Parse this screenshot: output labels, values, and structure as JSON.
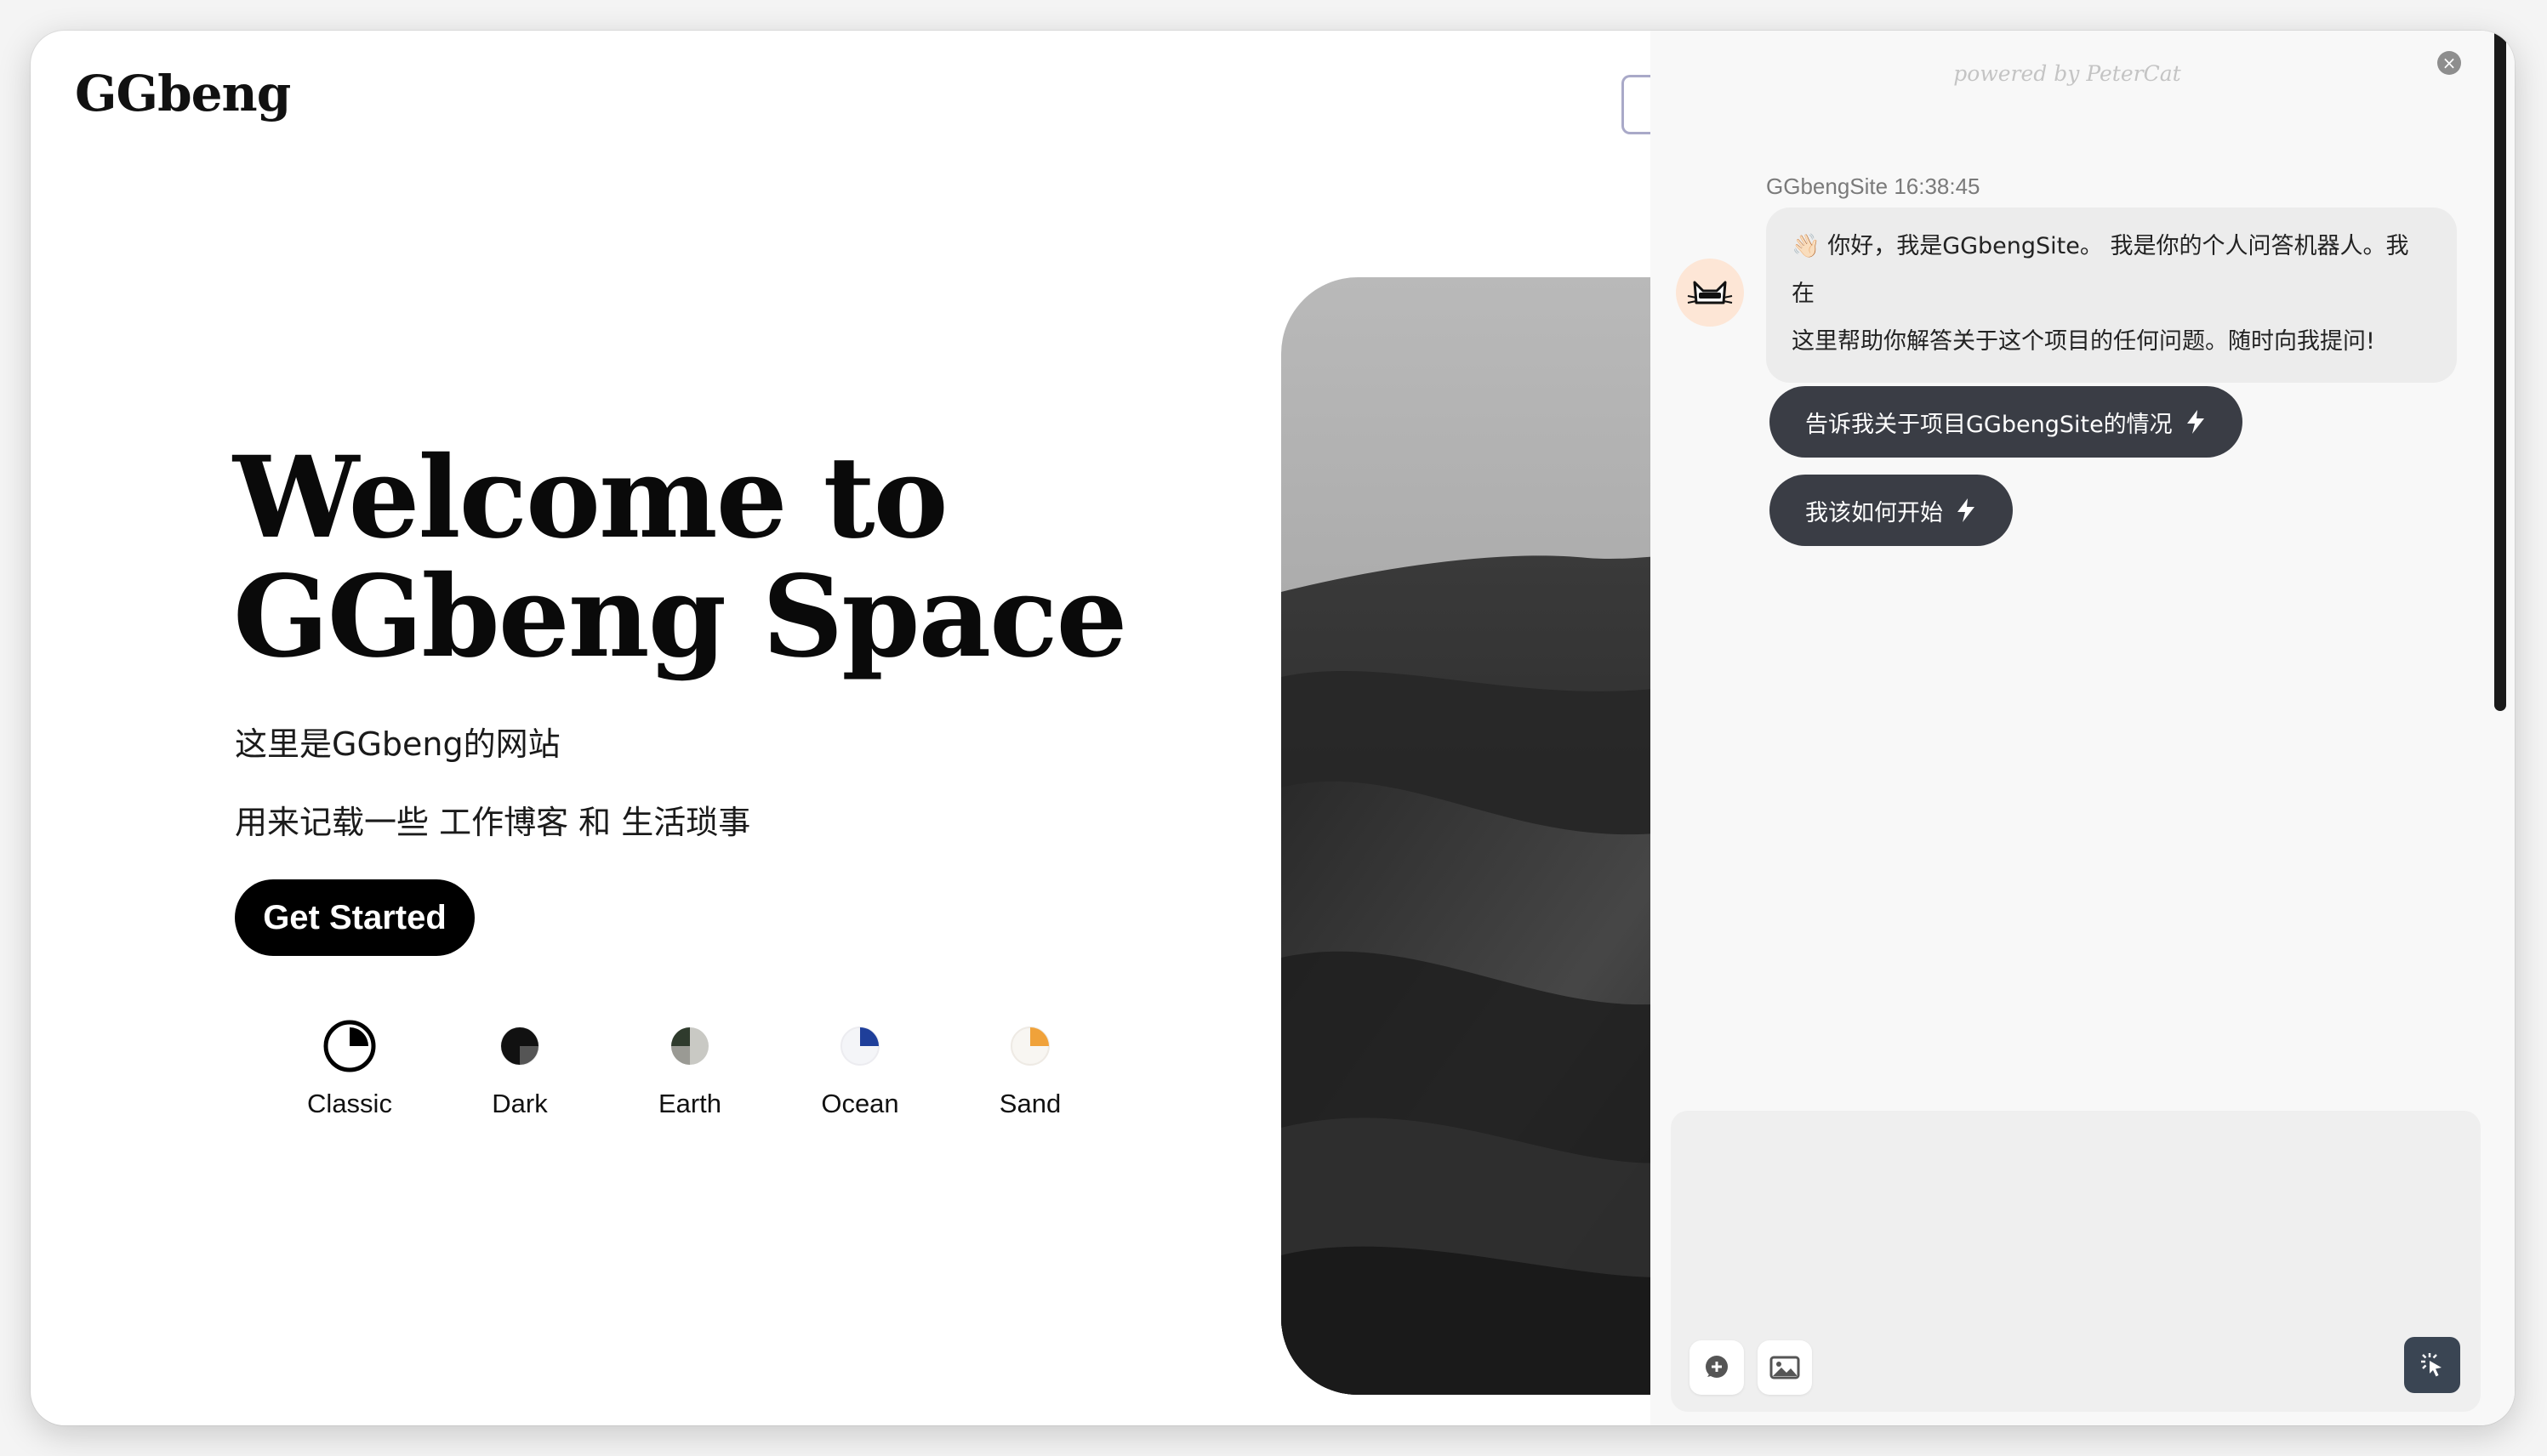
{
  "site": {
    "logo": "GGbeng",
    "hero_line1": "Welcome to",
    "hero_line2": "GGbeng Space",
    "subtitle1": "这里是GGbeng的网站",
    "subtitle2": "用来记载一些 工作博客 和 生活琐事",
    "cta_label": "Get Started",
    "themes": [
      {
        "label": "Classic",
        "icon": "classic-theme-icon",
        "accent": "#000000"
      },
      {
        "label": "Dark",
        "icon": "dark-theme-icon",
        "accent": "#1a1a1a"
      },
      {
        "label": "Earth",
        "icon": "earth-theme-icon",
        "accent": "#2f3b2d"
      },
      {
        "label": "Ocean",
        "icon": "ocean-theme-icon",
        "accent": "#1f3f9a"
      },
      {
        "label": "Sand",
        "icon": "sand-theme-icon",
        "accent": "#f0a23a"
      }
    ]
  },
  "chat": {
    "powered_by": "powered by PeterCat",
    "sender": "GGbengSite 16:38:45",
    "greeting_line1": "👋🏻 你好，我是GGbengSite。 我是你的个人问答机器人。我在",
    "greeting_line2": "这里帮助你解答关于这个项目的任何问题。随时向我提问!",
    "suggestions": [
      "告诉我关于项目GGbengSite的情况",
      "我该如何开始"
    ],
    "input_value": ""
  },
  "colors": {
    "chat_button": "#3a3d45",
    "send_button": "#3a4553",
    "avatar_bg": "#fde6d6"
  }
}
